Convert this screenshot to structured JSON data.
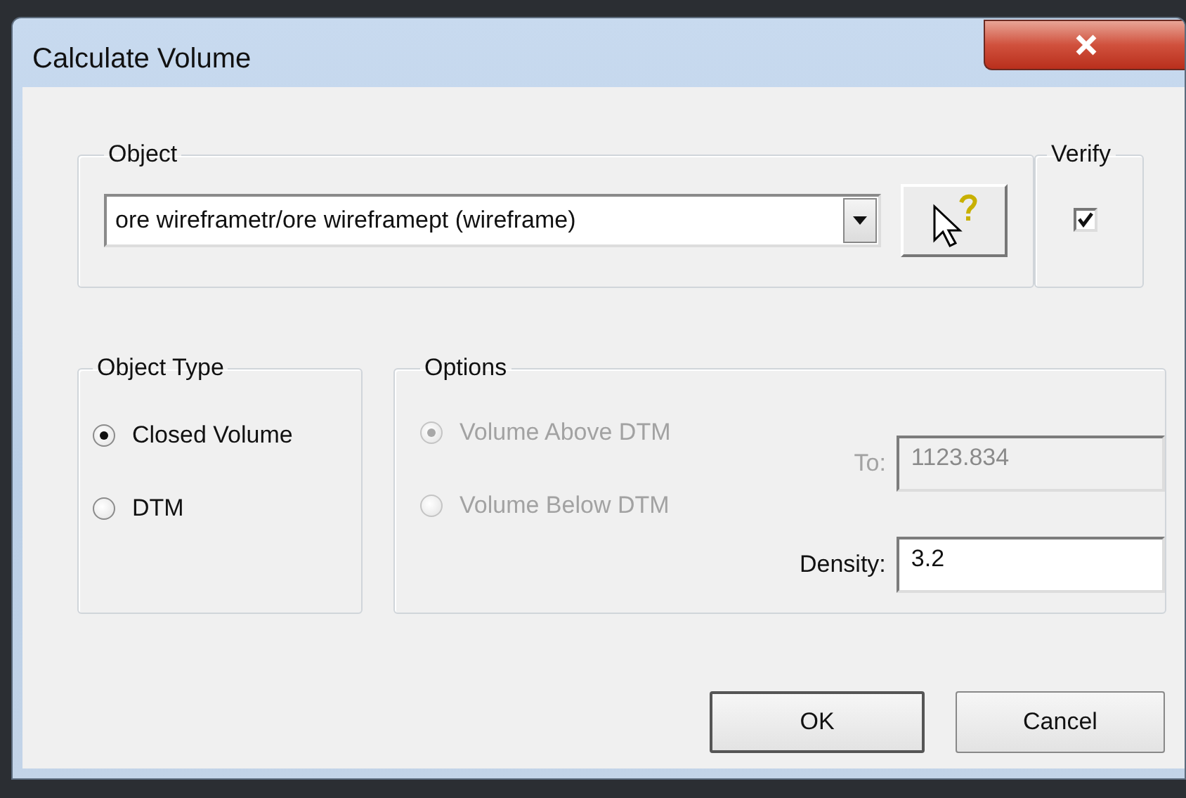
{
  "window": {
    "title": "Calculate Volume"
  },
  "object": {
    "legend": "Object",
    "value": "ore wireframetr/ore wireframept (wireframe)"
  },
  "verify": {
    "legend": "Verify",
    "checked": true
  },
  "object_type": {
    "legend": "Object Type",
    "options": [
      {
        "label": "Closed Volume",
        "selected": true
      },
      {
        "label": "DTM",
        "selected": false
      }
    ]
  },
  "options": {
    "legend": "Options",
    "disabled": true,
    "radios": [
      {
        "label": "Volume Above DTM",
        "selected": true
      },
      {
        "label": "Volume Below DTM",
        "selected": false
      }
    ],
    "to": {
      "label": "To:",
      "value": "1123.834",
      "disabled": true
    },
    "density": {
      "label": "Density:",
      "value": "3.2",
      "disabled": false
    }
  },
  "buttons": [
    {
      "label": "OK",
      "default": true
    },
    {
      "label": "Cancel",
      "default": false
    }
  ]
}
